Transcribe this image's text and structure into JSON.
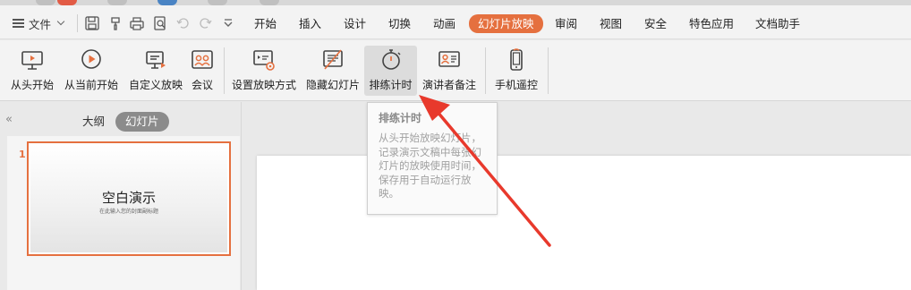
{
  "menubar": {
    "file_label": "文件",
    "tabs": [
      {
        "label": "开始"
      },
      {
        "label": "插入"
      },
      {
        "label": "设计"
      },
      {
        "label": "切换"
      },
      {
        "label": "动画"
      },
      {
        "label": "幻灯片放映",
        "active": true
      },
      {
        "label": "审阅"
      },
      {
        "label": "视图"
      },
      {
        "label": "安全"
      },
      {
        "label": "特色应用"
      },
      {
        "label": "文档助手"
      }
    ],
    "quick_access_icons": [
      "save-icon",
      "format-painter-icon",
      "print-icon",
      "print-preview-icon",
      "undo-icon",
      "redo-icon",
      "more-dropdown-icon"
    ]
  },
  "ribbon": {
    "buttons": [
      {
        "label": "从头开始",
        "icon": "play-from-start-icon"
      },
      {
        "label": "从当前开始",
        "icon": "play-from-current-icon"
      },
      {
        "label": "自定义放映",
        "icon": "custom-show-icon"
      },
      {
        "label": "会议",
        "icon": "meeting-icon"
      },
      {
        "label": "设置放映方式",
        "icon": "setup-show-icon"
      },
      {
        "label": "隐藏幻灯片",
        "icon": "hide-slide-icon"
      },
      {
        "label": "排练计时",
        "icon": "stopwatch-icon"
      },
      {
        "label": "演讲者备注",
        "icon": "speaker-notes-icon"
      },
      {
        "label": "手机遥控",
        "icon": "phone-remote-icon"
      }
    ]
  },
  "tooltip": {
    "title": "排练计时",
    "lines": [
      "从头开始放映幻灯片，",
      "记录演示文稿中每张幻",
      "灯片的放映使用时间，",
      "保存用于自动运行放",
      "映。"
    ]
  },
  "left_pane": {
    "collapse_glyph": "«",
    "tab_outline": "大纲",
    "tab_slides": "幻灯片",
    "slide_number": "1",
    "thumb_title": "空白演示",
    "thumb_subtitle": "在此输入您的封面副标题"
  },
  "colors": {
    "accent": "#e5703f",
    "arrow": "#e8392c"
  }
}
